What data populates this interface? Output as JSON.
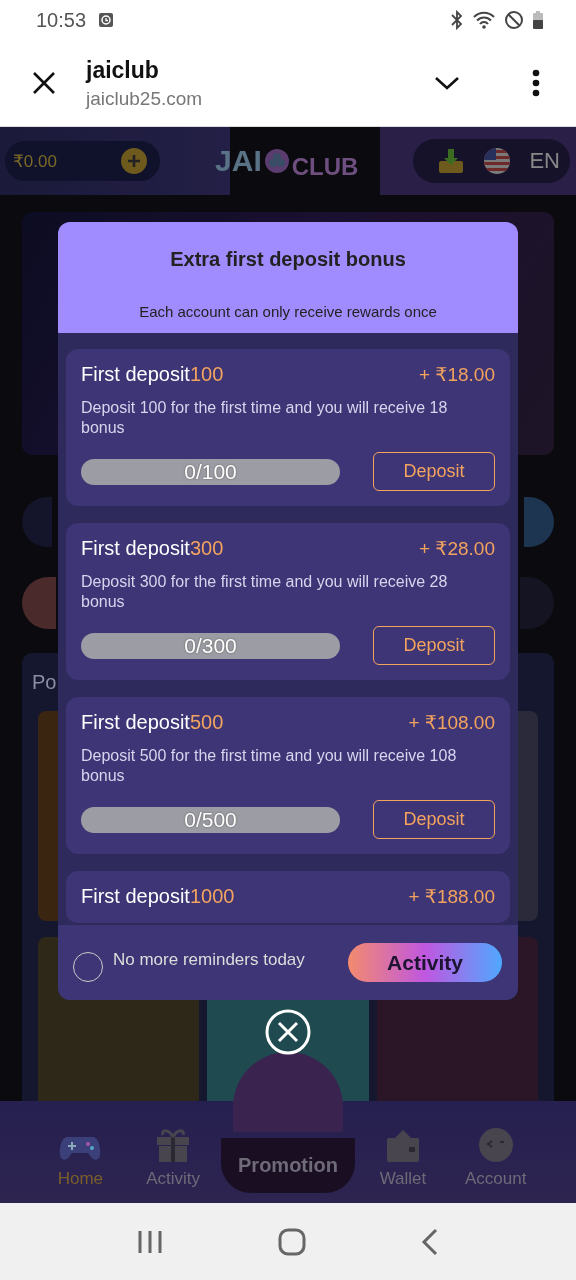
{
  "status_bar": {
    "time": "10:53"
  },
  "browser": {
    "title": "jaiclub",
    "url": "jaiclub25.com"
  },
  "app_header": {
    "balance": "₹0.00",
    "logo": [
      "JAI",
      "CLUB"
    ],
    "language": "EN"
  },
  "section": {
    "title": "Po"
  },
  "popup": {
    "title": "Extra first deposit bonus",
    "subtitle": "Each account can only receive rewards once",
    "offers": [
      {
        "title": "First deposit",
        "amount": "100",
        "reward": "+ ₹18.00",
        "description": "Deposit 100 for the first time and you will receive 18 bonus",
        "progress": "0/100",
        "level": 0,
        "button": "Deposit"
      },
      {
        "title": "First deposit",
        "amount": "300",
        "reward": "+ ₹28.00",
        "description": "Deposit 300 for the first time and you will receive 28 bonus",
        "progress": "0/300",
        "level": 0,
        "button": "Deposit"
      },
      {
        "title": "First deposit",
        "amount": "500",
        "reward": "+ ₹108.00",
        "description": "Deposit 500 for the first time and you will receive 108 bonus",
        "progress": "0/500",
        "level": 0,
        "button": "Deposit"
      },
      {
        "title": "First deposit",
        "amount": "1000",
        "reward": "+ ₹188.00"
      }
    ],
    "reminder": {
      "label": "No more reminders today",
      "checked": false
    },
    "action": "Activity"
  },
  "bottom_nav": [
    {
      "label": "Home",
      "kind": "game",
      "selected": true
    },
    {
      "label": "Activity",
      "kind": "gift",
      "selected": false
    },
    {
      "label": "Promotion",
      "kind": "center",
      "selected": false
    },
    {
      "label": "Wallet",
      "kind": "wallet",
      "selected": false
    },
    {
      "label": "Account",
      "kind": "account",
      "selected": false
    }
  ]
}
